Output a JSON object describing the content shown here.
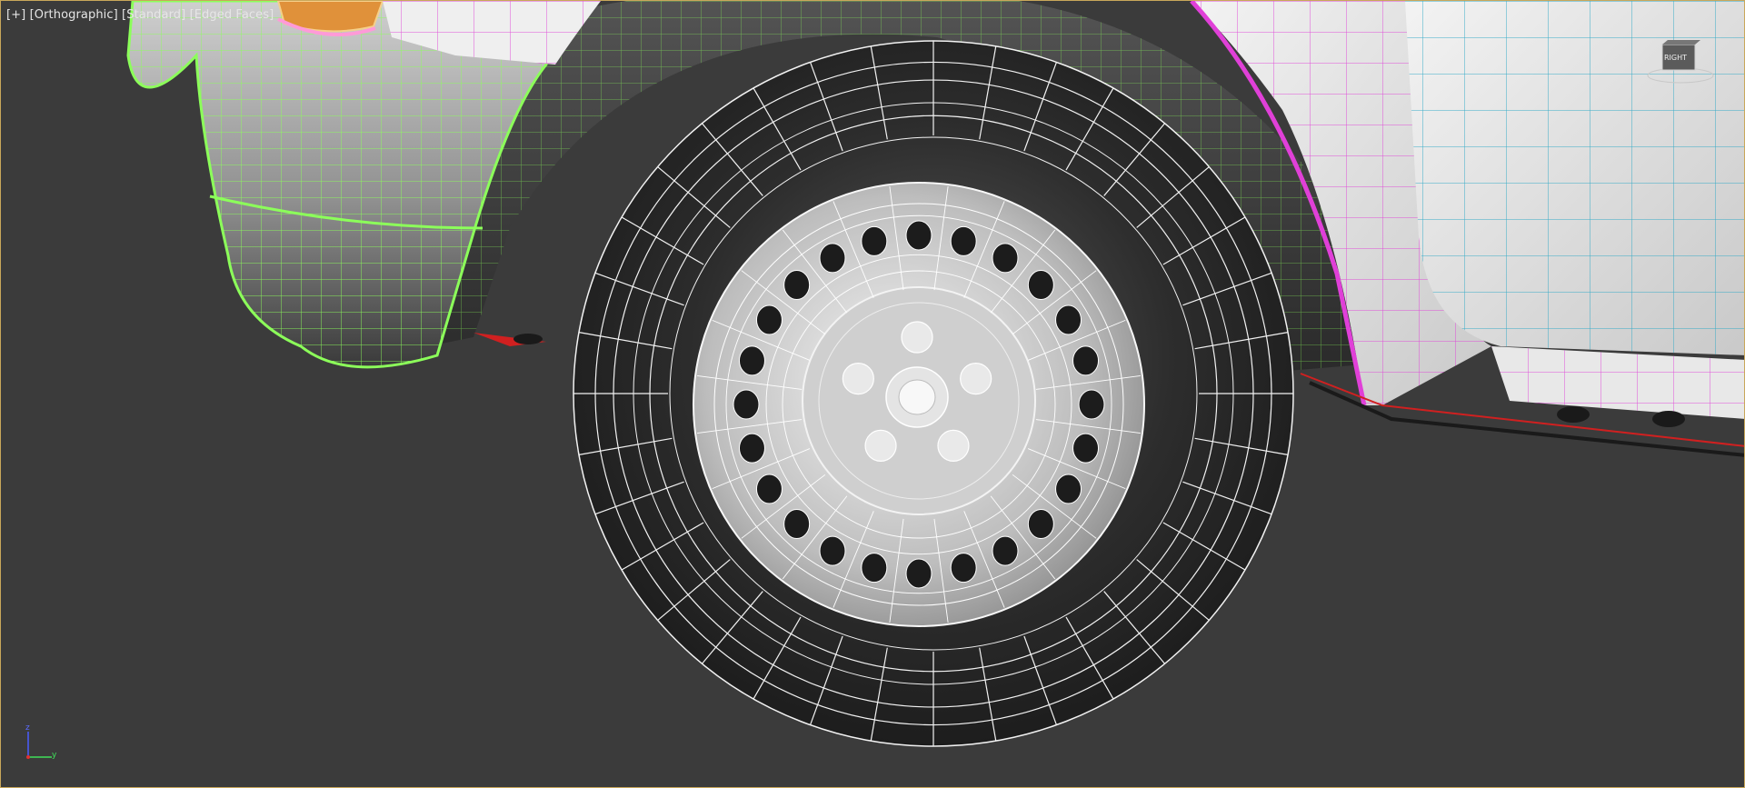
{
  "viewport": {
    "label_plus": "[+]",
    "label_view": "[Orthographic]",
    "label_shading": "[Standard] [Edged Faces]"
  },
  "viewcube": {
    "face_label": "RIGHT"
  },
  "axis_gizmo": {
    "z_label": "z",
    "y_label": "y"
  },
  "colors": {
    "background": "#3b3b3b",
    "viewport_border": "#c9a75a",
    "wire_green": "#8cff5a",
    "wire_magenta": "#e040d8",
    "wire_cyan": "#2fa9c6",
    "wire_white": "#f2f2f2",
    "tire_dark": "#2a2a2a"
  }
}
